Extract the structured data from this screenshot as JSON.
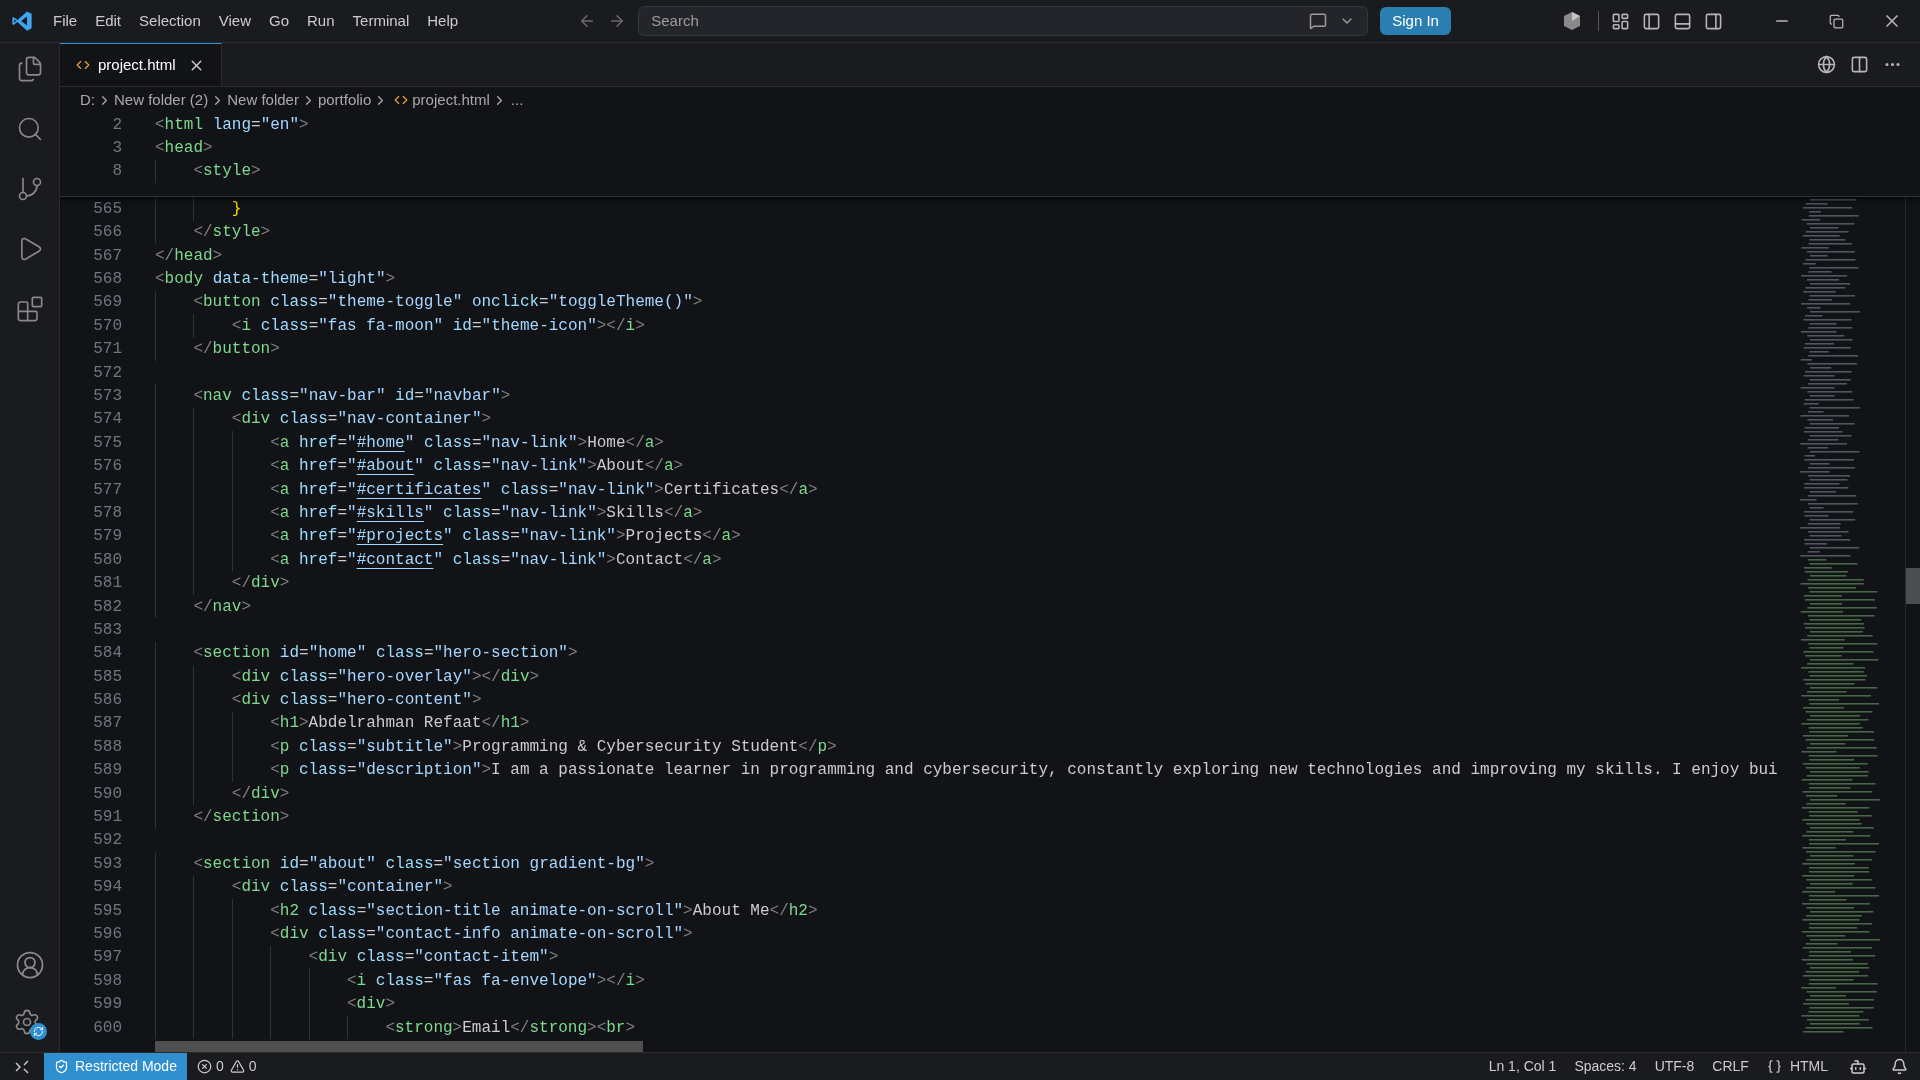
{
  "title_bar": {
    "menus": [
      "File",
      "Edit",
      "Selection",
      "View",
      "Go",
      "Run",
      "Terminal",
      "Help"
    ],
    "search": {
      "placeholder": "Search"
    },
    "sign_in": "Sign In"
  },
  "tabs": [
    {
      "label": "project.html",
      "selected": true
    }
  ],
  "breadcrumbs": [
    {
      "label": "D:",
      "kind": "folder"
    },
    {
      "label": "New folder (2)",
      "kind": "folder"
    },
    {
      "label": "New folder",
      "kind": "folder"
    },
    {
      "label": "portfolio",
      "kind": "folder"
    },
    {
      "label": "project.html",
      "kind": "file"
    },
    {
      "label": "...",
      "kind": "more"
    }
  ],
  "sticky_lines": [
    {
      "number": "2",
      "code": "<html lang=\"en\">"
    },
    {
      "number": "3",
      "code": "<head>"
    },
    {
      "number": "8",
      "code": "    <style>"
    }
  ],
  "lines": [
    {
      "number": "565",
      "code": "        }"
    },
    {
      "number": "566",
      "code": "    </style>"
    },
    {
      "number": "567",
      "code": "</head>"
    },
    {
      "number": "568",
      "code": "<body data-theme=\"light\">"
    },
    {
      "number": "569",
      "code": "    <button class=\"theme-toggle\" onclick=\"toggleTheme()\">"
    },
    {
      "number": "570",
      "code": "        <i class=\"fas fa-moon\" id=\"theme-icon\"></i>"
    },
    {
      "number": "571",
      "code": "    </button>"
    },
    {
      "number": "572"
    },
    {
      "number": "573",
      "code": "    <nav class=\"nav-bar\" id=\"navbar\">"
    },
    {
      "number": "574",
      "code": "        <div class=\"nav-container\">"
    },
    {
      "number": "575",
      "code": "            <a href=\"#home\" class=\"nav-link\">Home</a>"
    },
    {
      "number": "576",
      "code": "            <a href=\"#about\" class=\"nav-link\">About</a>"
    },
    {
      "number": "577",
      "code": "            <a href=\"#certificates\" class=\"nav-link\">Certificates</a>"
    },
    {
      "number": "578",
      "code": "            <a href=\"#skills\" class=\"nav-link\">Skills</a>"
    },
    {
      "number": "579",
      "code": "            <a href=\"#projects\" class=\"nav-link\">Projects</a>"
    },
    {
      "number": "580",
      "code": "            <a href=\"#contact\" class=\"nav-link\">Contact</a>"
    },
    {
      "number": "581",
      "code": "        </div>"
    },
    {
      "number": "582",
      "code": "    </nav>"
    },
    {
      "number": "583"
    },
    {
      "number": "584",
      "code": "    <section id=\"home\" class=\"hero-section\">"
    },
    {
      "number": "585",
      "code": "        <div class=\"hero-overlay\"></div>"
    },
    {
      "number": "586",
      "code": "        <div class=\"hero-content\">"
    },
    {
      "number": "587",
      "code": "            <h1>Abdelrahman Refaat</h1>"
    },
    {
      "number": "588",
      "code": "            <p class=\"subtitle\">Programming & Cybersecurity Student</p>"
    },
    {
      "number": "589",
      "code": "            <p class=\"description\">I am a passionate learner in programming and cybersecurity, constantly exploring new technologies and improving my skills. I enjoy bui"
    },
    {
      "number": "590",
      "code": "        </div>"
    },
    {
      "number": "591",
      "code": "    </section>"
    },
    {
      "number": "592"
    },
    {
      "number": "593",
      "code": "    <section id=\"about\" class=\"section gradient-bg\">"
    },
    {
      "number": "594",
      "code": "        <div class=\"container\">"
    },
    {
      "number": "595",
      "code": "            <h2 class=\"section-title animate-on-scroll\">About Me</h2>"
    },
    {
      "number": "596",
      "code": "            <div class=\"contact-info animate-on-scroll\">"
    },
    {
      "number": "597",
      "code": "                <div class=\"contact-item\">"
    },
    {
      "number": "598",
      "code": "                    <i class=\"fas fa-envelope\"></i>"
    },
    {
      "number": "599",
      "code": "                    <div>"
    },
    {
      "number": "600",
      "code": "                        <strong>Email</strong><br>"
    }
  ],
  "status_bar": {
    "mode": "Restricted Mode",
    "errors": "0",
    "warnings": "0",
    "items": [
      "Ln 1, Col 1",
      "Spaces: 4",
      "UTF-8",
      "CRLF"
    ],
    "language": "HTML"
  }
}
